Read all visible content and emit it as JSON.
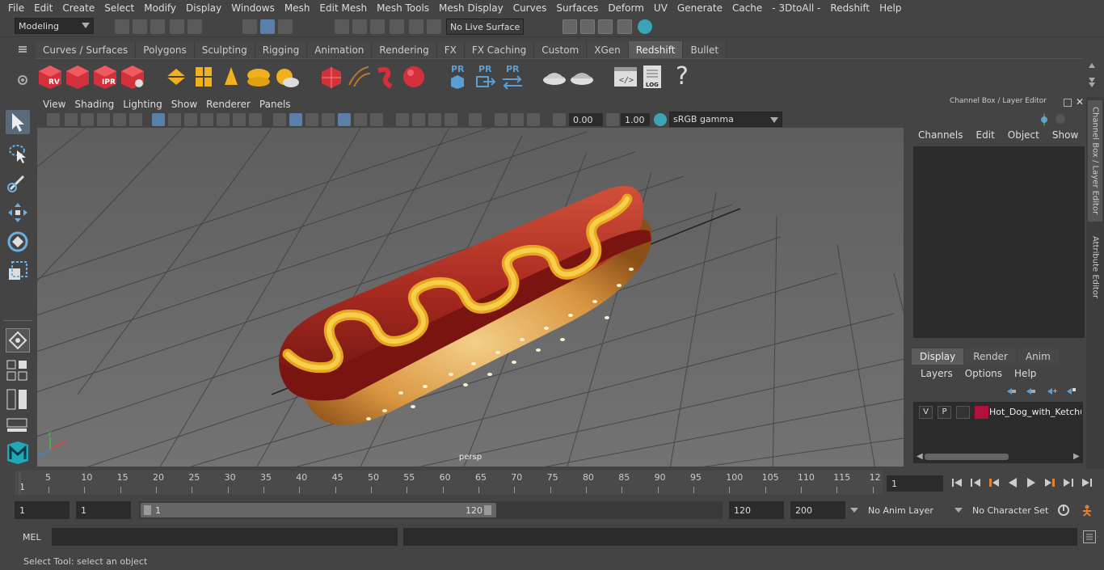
{
  "menubar": {
    "items": [
      "File",
      "Edit",
      "Create",
      "Select",
      "Modify",
      "Display",
      "Windows",
      "Mesh",
      "Edit Mesh",
      "Mesh Tools",
      "Mesh Display",
      "Curves",
      "Surfaces",
      "Deform",
      "UV",
      "Generate",
      "Cache",
      "- 3DtoAll -",
      "Redshift",
      "Help"
    ]
  },
  "statusline": {
    "menuset": "Modeling",
    "live_surface": "No Live Surface"
  },
  "shelf": {
    "tabs": [
      "Curves / Surfaces",
      "Polygons",
      "Sculpting",
      "Rigging",
      "Animation",
      "Rendering",
      "FX",
      "FX Caching",
      "Custom",
      "XGen",
      "Redshift",
      "Bullet"
    ],
    "active_tab": "Redshift",
    "labels": {
      "rv": "RV",
      "ipr": "IPR",
      "pr": "PR",
      "log": "LOG",
      "help": "?"
    }
  },
  "viewport": {
    "menu": [
      "View",
      "Shading",
      "Lighting",
      "Show",
      "Renderer",
      "Panels"
    ],
    "exposure": "0.00",
    "gamma": "1.00",
    "color_space": "sRGB gamma",
    "camera_label": "persp",
    "axis": {
      "x": "x",
      "y": "y",
      "z": "z"
    }
  },
  "right_panel": {
    "title": "Channel Box / Layer Editor",
    "menu": [
      "Channels",
      "Edit",
      "Object",
      "Show"
    ],
    "layer_tabs": [
      "Display",
      "Render",
      "Anim"
    ],
    "active_layer_tab": "Display",
    "layer_menu": [
      "Layers",
      "Options",
      "Help"
    ],
    "layer": {
      "v": "V",
      "p": "P",
      "name": "Hot_Dog_with_Ketchu",
      "color": "#b0103a"
    },
    "side_tabs": [
      "Channel Box / Layer Editor",
      "Attribute Editor"
    ]
  },
  "timeline": {
    "ticks": [
      "5",
      "10",
      "15",
      "20",
      "25",
      "30",
      "35",
      "40",
      "45",
      "50",
      "55",
      "60",
      "65",
      "70",
      "75",
      "80",
      "85",
      "90",
      "95",
      "100",
      "105",
      "110",
      "115",
      "12"
    ],
    "current_marker": "1",
    "current_frame": "1"
  },
  "range": {
    "start": "1",
    "playback_start": "1",
    "slider_start": "1",
    "slider_end": "120",
    "playback_end": "120",
    "end": "200",
    "anim_layer": "No Anim Layer",
    "character_set": "No Character Set"
  },
  "command": {
    "language": "MEL"
  },
  "help_line": "Select Tool: select an object",
  "colors": {
    "background": "#444444",
    "viewport": "#6a6a6a",
    "field": "#2b2b2b",
    "redshift": "#d2303a",
    "accent_blue": "#5a9fd4"
  }
}
